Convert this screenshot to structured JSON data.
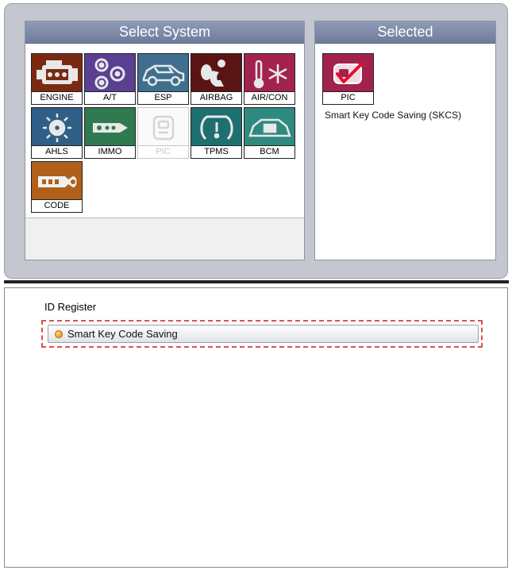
{
  "select_system": {
    "title": "Select System",
    "systems": [
      {
        "label": "ENGINE",
        "icon": "engine-icon",
        "color": "#7a2a12"
      },
      {
        "label": "A/T",
        "icon": "gears-icon",
        "color": "#5a3f92"
      },
      {
        "label": "ESP",
        "icon": "car-icon",
        "color": "#3e6f8f"
      },
      {
        "label": "AIRBAG",
        "icon": "airbag-icon",
        "color": "#5a1414"
      },
      {
        "label": "AIR/CON",
        "icon": "aircon-icon",
        "color": "#a2224e"
      },
      {
        "label": "AHLS",
        "icon": "headlamp-icon",
        "color": "#2f5f86"
      },
      {
        "label": "IMMO",
        "icon": "key-icon",
        "color": "#2f7a4f"
      },
      {
        "label": "PIC",
        "icon": "smartkey-icon",
        "color": "#cfcfcf",
        "disabled": true
      },
      {
        "label": "TPMS",
        "icon": "tire-icon",
        "color": "#1e6f6f"
      },
      {
        "label": "BCM",
        "icon": "body-icon",
        "color": "#2e8a7e"
      },
      {
        "label": "CODE",
        "icon": "code-key-icon",
        "color": "#b0601a"
      }
    ]
  },
  "selected": {
    "title": "Selected",
    "item": {
      "label": "PIC",
      "icon": "smartkey-check-icon",
      "color": "#a2224e"
    },
    "description": "Smart Key Code Saving (SKCS)"
  },
  "id_register": {
    "title": "ID Register",
    "option_label": "Smart Key Code Saving",
    "highlight_color": "#d9534f"
  }
}
